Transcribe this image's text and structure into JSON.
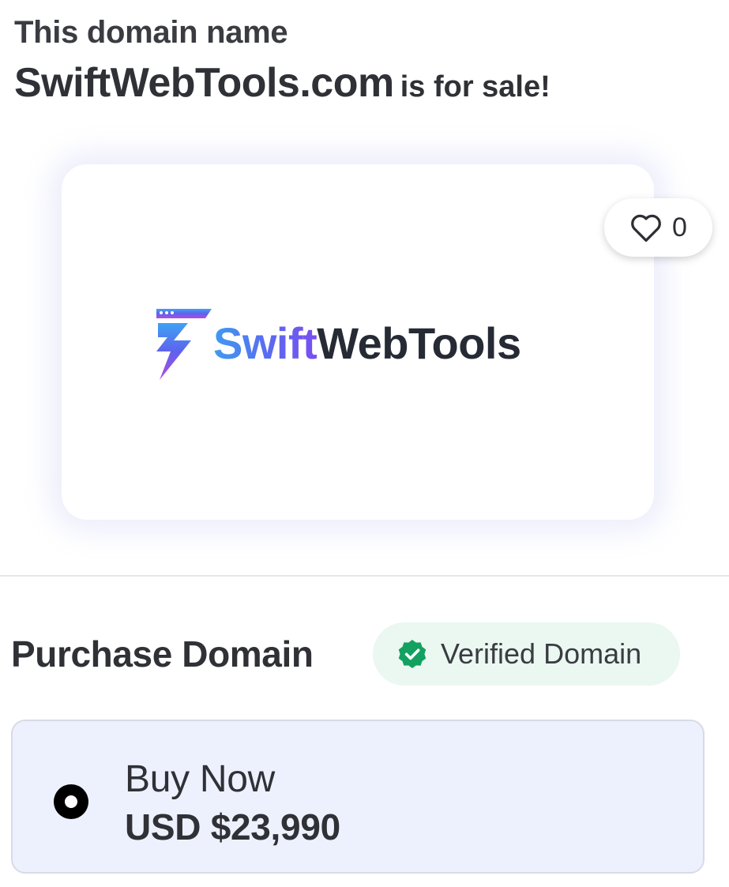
{
  "headline": {
    "line1": "This domain name",
    "domain": "SwiftWebTools.com",
    "suffix": "is for sale!"
  },
  "logo": {
    "text_part1": "Swift",
    "text_part2": "WebTools",
    "icon": "lightning-browser-icon",
    "gradient_colors": [
      "#3f9bf1",
      "#5b6af0",
      "#7a4ef0"
    ],
    "text_dark_color": "#252a34"
  },
  "like": {
    "icon": "heart-outline-icon",
    "count": "0"
  },
  "purchase": {
    "title": "Purchase Domain",
    "verified_badge": {
      "icon": "verified-check-badge-icon",
      "label": "Verified Domain",
      "color": "#12a160"
    },
    "options": [
      {
        "label": "Buy Now",
        "price": "USD $23,990",
        "selected": true
      }
    ]
  }
}
